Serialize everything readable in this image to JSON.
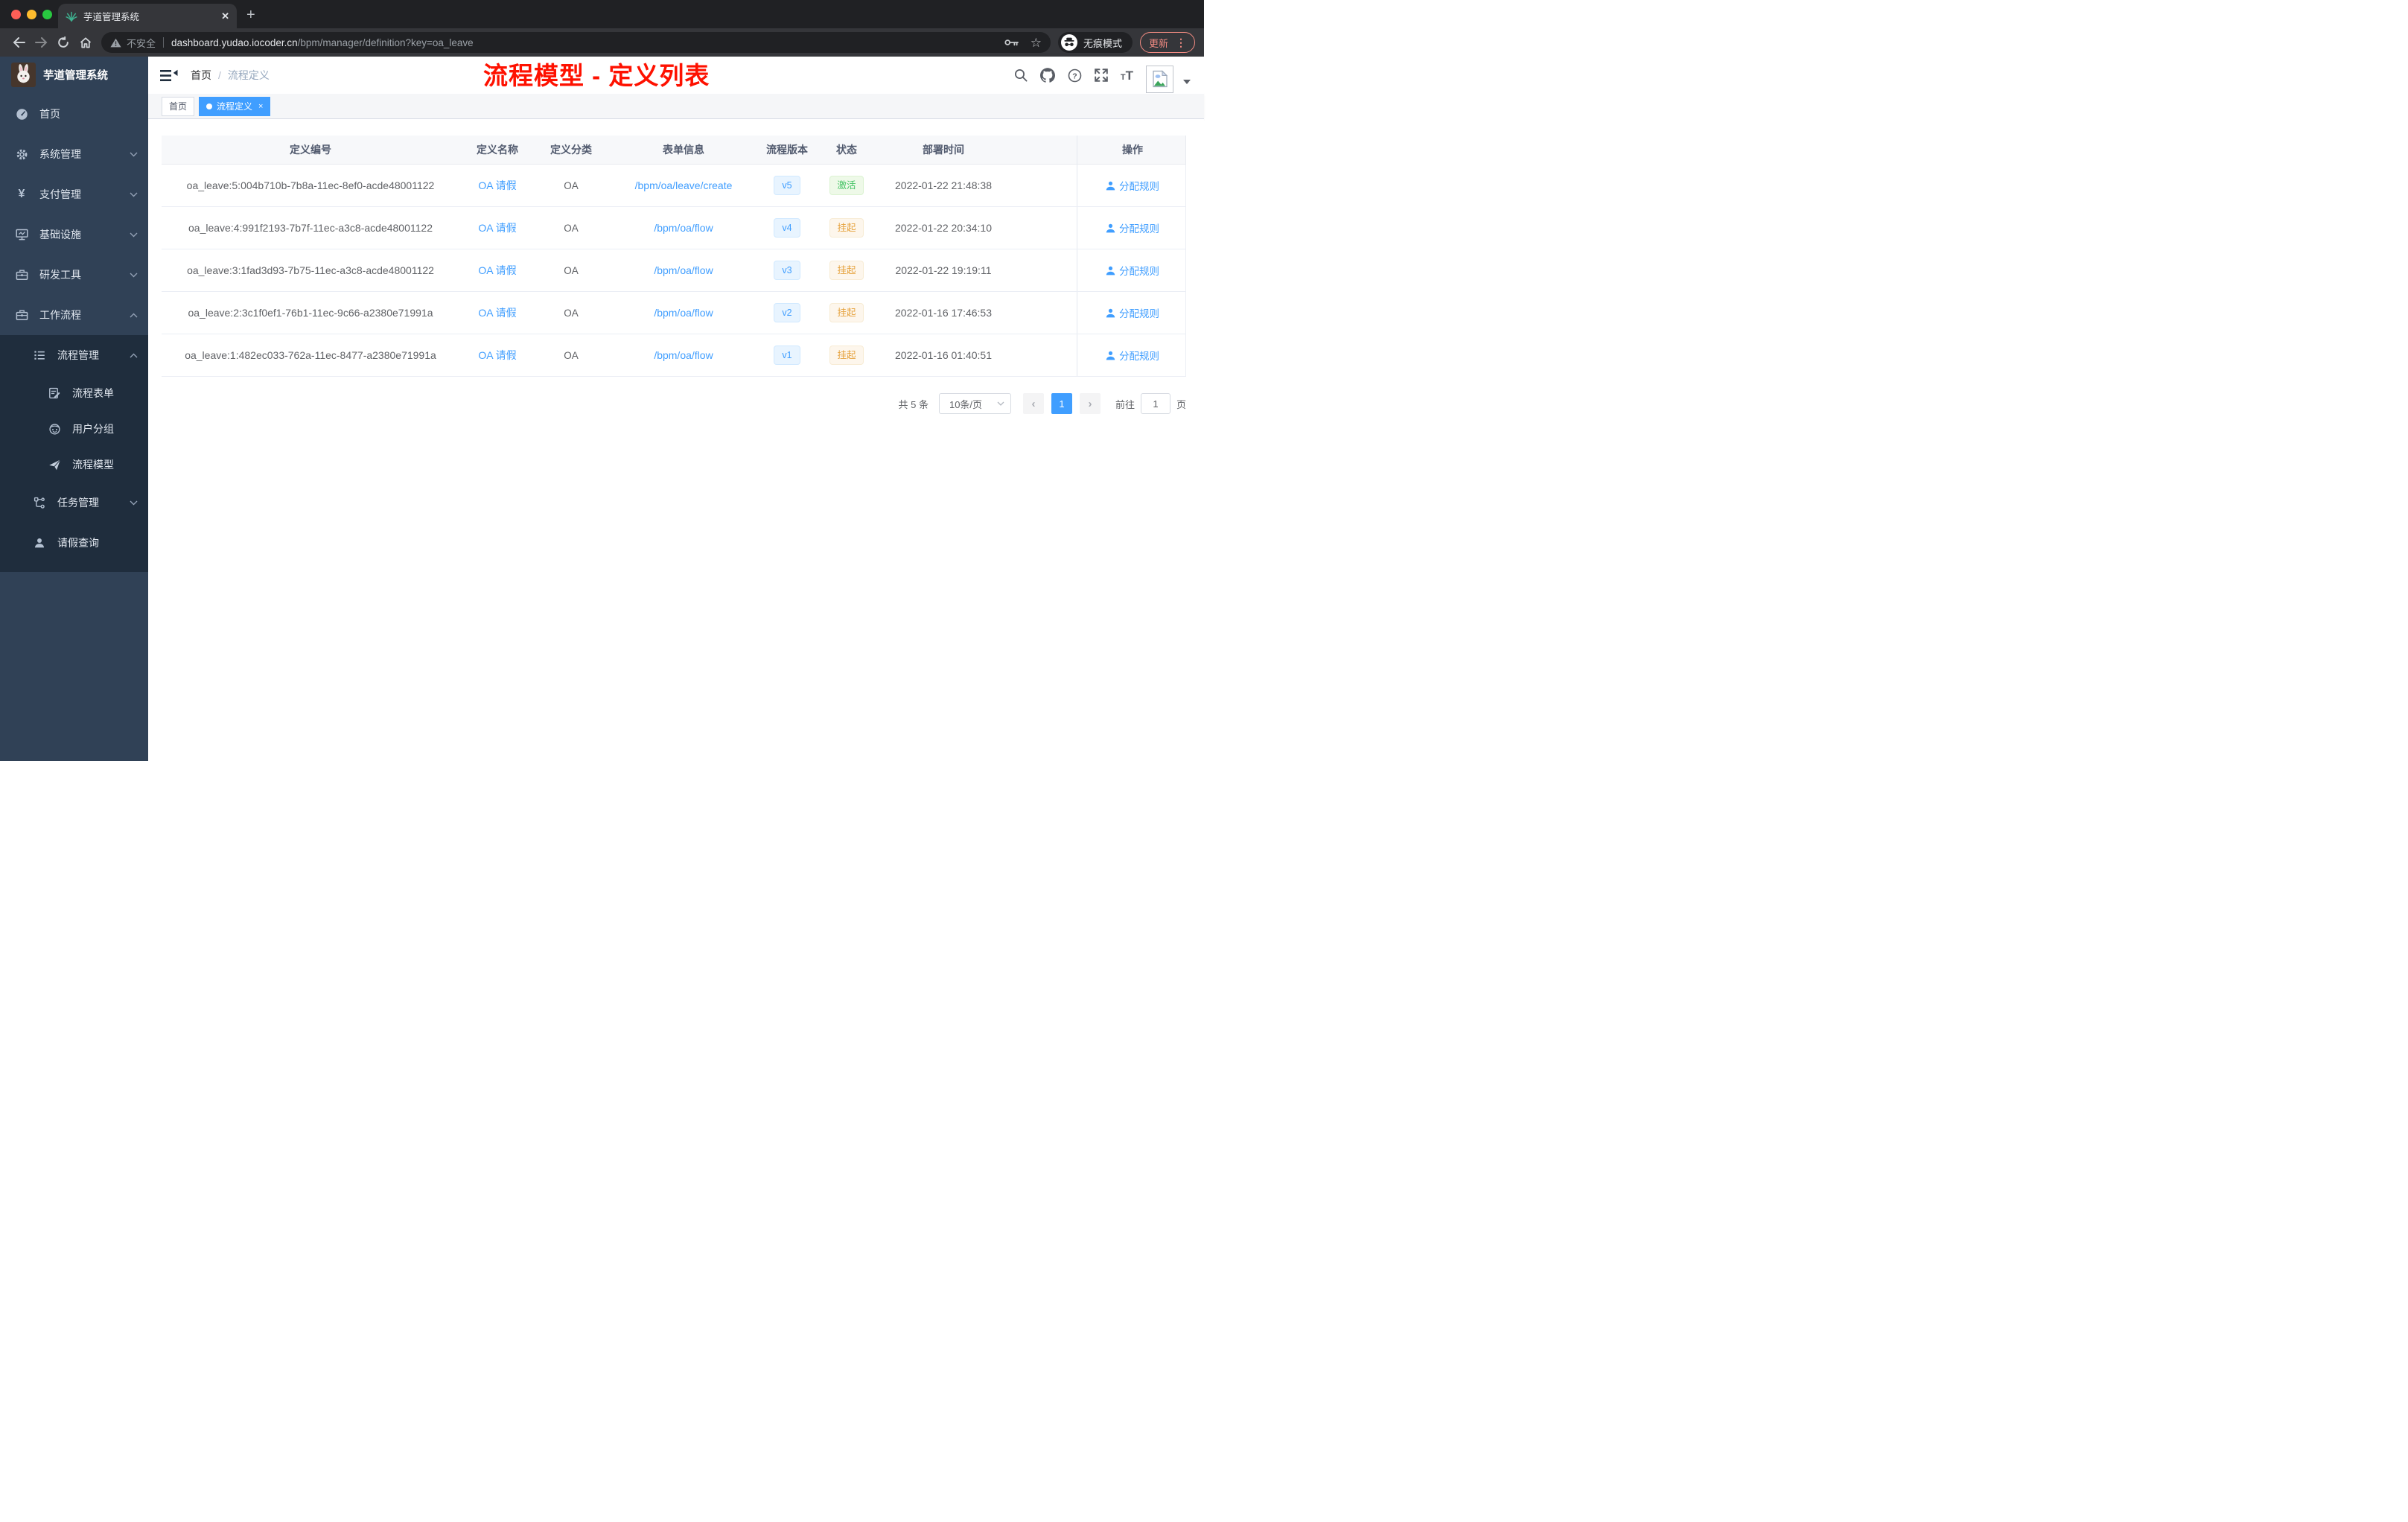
{
  "browser": {
    "tab": {
      "title": "芋道管理系统"
    },
    "toolbar": {
      "security": "不安全",
      "host": "dashboard.yudao.iocoder.cn",
      "path": "/bpm/manager/definition?key=oa_leave",
      "incognito": "无痕模式",
      "update": "更新",
      "more_dots": "⋮"
    }
  },
  "sidebar": {
    "logo": "芋道管理系统",
    "items": [
      {
        "label": "首页"
      },
      {
        "label": "系统管理"
      },
      {
        "label": "支付管理"
      },
      {
        "label": "基础设施"
      },
      {
        "label": "研发工具"
      },
      {
        "label": "工作流程"
      }
    ],
    "process_group": {
      "label": "流程管理"
    },
    "process_children": [
      {
        "label": "流程表单"
      },
      {
        "label": "用户分组"
      },
      {
        "label": "流程模型"
      }
    ],
    "task_group": {
      "label": "任务管理"
    },
    "leave_item": {
      "label": "请假查询"
    }
  },
  "navbar": {
    "breadcrumb_home": "首页",
    "breadcrumb_separator": "/",
    "breadcrumb_current": "流程定义",
    "annotation": "流程模型 - 定义列表"
  },
  "tags": {
    "home": "首页",
    "active": "流程定义",
    "close": "×"
  },
  "table": {
    "columns": [
      "定义编号",
      "定义名称",
      "定义分类",
      "表单信息",
      "流程版本",
      "状态",
      "部署时间",
      "操作"
    ],
    "action_label": "分配规则",
    "rows": [
      {
        "id": "oa_leave:5:004b710b-7b8a-11ec-8ef0-acde48001122",
        "name": "OA 请假",
        "category": "OA",
        "form": "/bpm/oa/leave/create",
        "version": "v5",
        "status": "激活",
        "time": "2022-01-22 21:48:38"
      },
      {
        "id": "oa_leave:4:991f2193-7b7f-11ec-a3c8-acde48001122",
        "name": "OA 请假",
        "category": "OA",
        "form": "/bpm/oa/flow",
        "version": "v4",
        "status": "挂起",
        "time": "2022-01-22 20:34:10"
      },
      {
        "id": "oa_leave:3:1fad3d93-7b75-11ec-a3c8-acde48001122",
        "name": "OA 请假",
        "category": "OA",
        "form": "/bpm/oa/flow",
        "version": "v3",
        "status": "挂起",
        "time": "2022-01-22 19:19:11"
      },
      {
        "id": "oa_leave:2:3c1f0ef1-76b1-11ec-9c66-a2380e71991a",
        "name": "OA 请假",
        "category": "OA",
        "form": "/bpm/oa/flow",
        "version": "v2",
        "status": "挂起",
        "time": "2022-01-16 17:46:53"
      },
      {
        "id": "oa_leave:1:482ec033-762a-11ec-8477-a2380e71991a",
        "name": "OA 请假",
        "category": "OA",
        "form": "/bpm/oa/flow",
        "version": "v1",
        "status": "挂起",
        "time": "2022-01-16 01:40:51"
      }
    ]
  },
  "pagination": {
    "total": "共 5 条",
    "page_size": "10条/页",
    "current_page": "1",
    "goto_label": "前往",
    "goto_value": "1",
    "page_unit": "页"
  },
  "colors": {
    "accent": "#409eff",
    "status_active": "#42c363",
    "status_suspended": "#e6a23c",
    "annotation_red": "#fe1100",
    "sidebar_bg": "#304156",
    "submenu_bg": "#1f2d3d"
  }
}
